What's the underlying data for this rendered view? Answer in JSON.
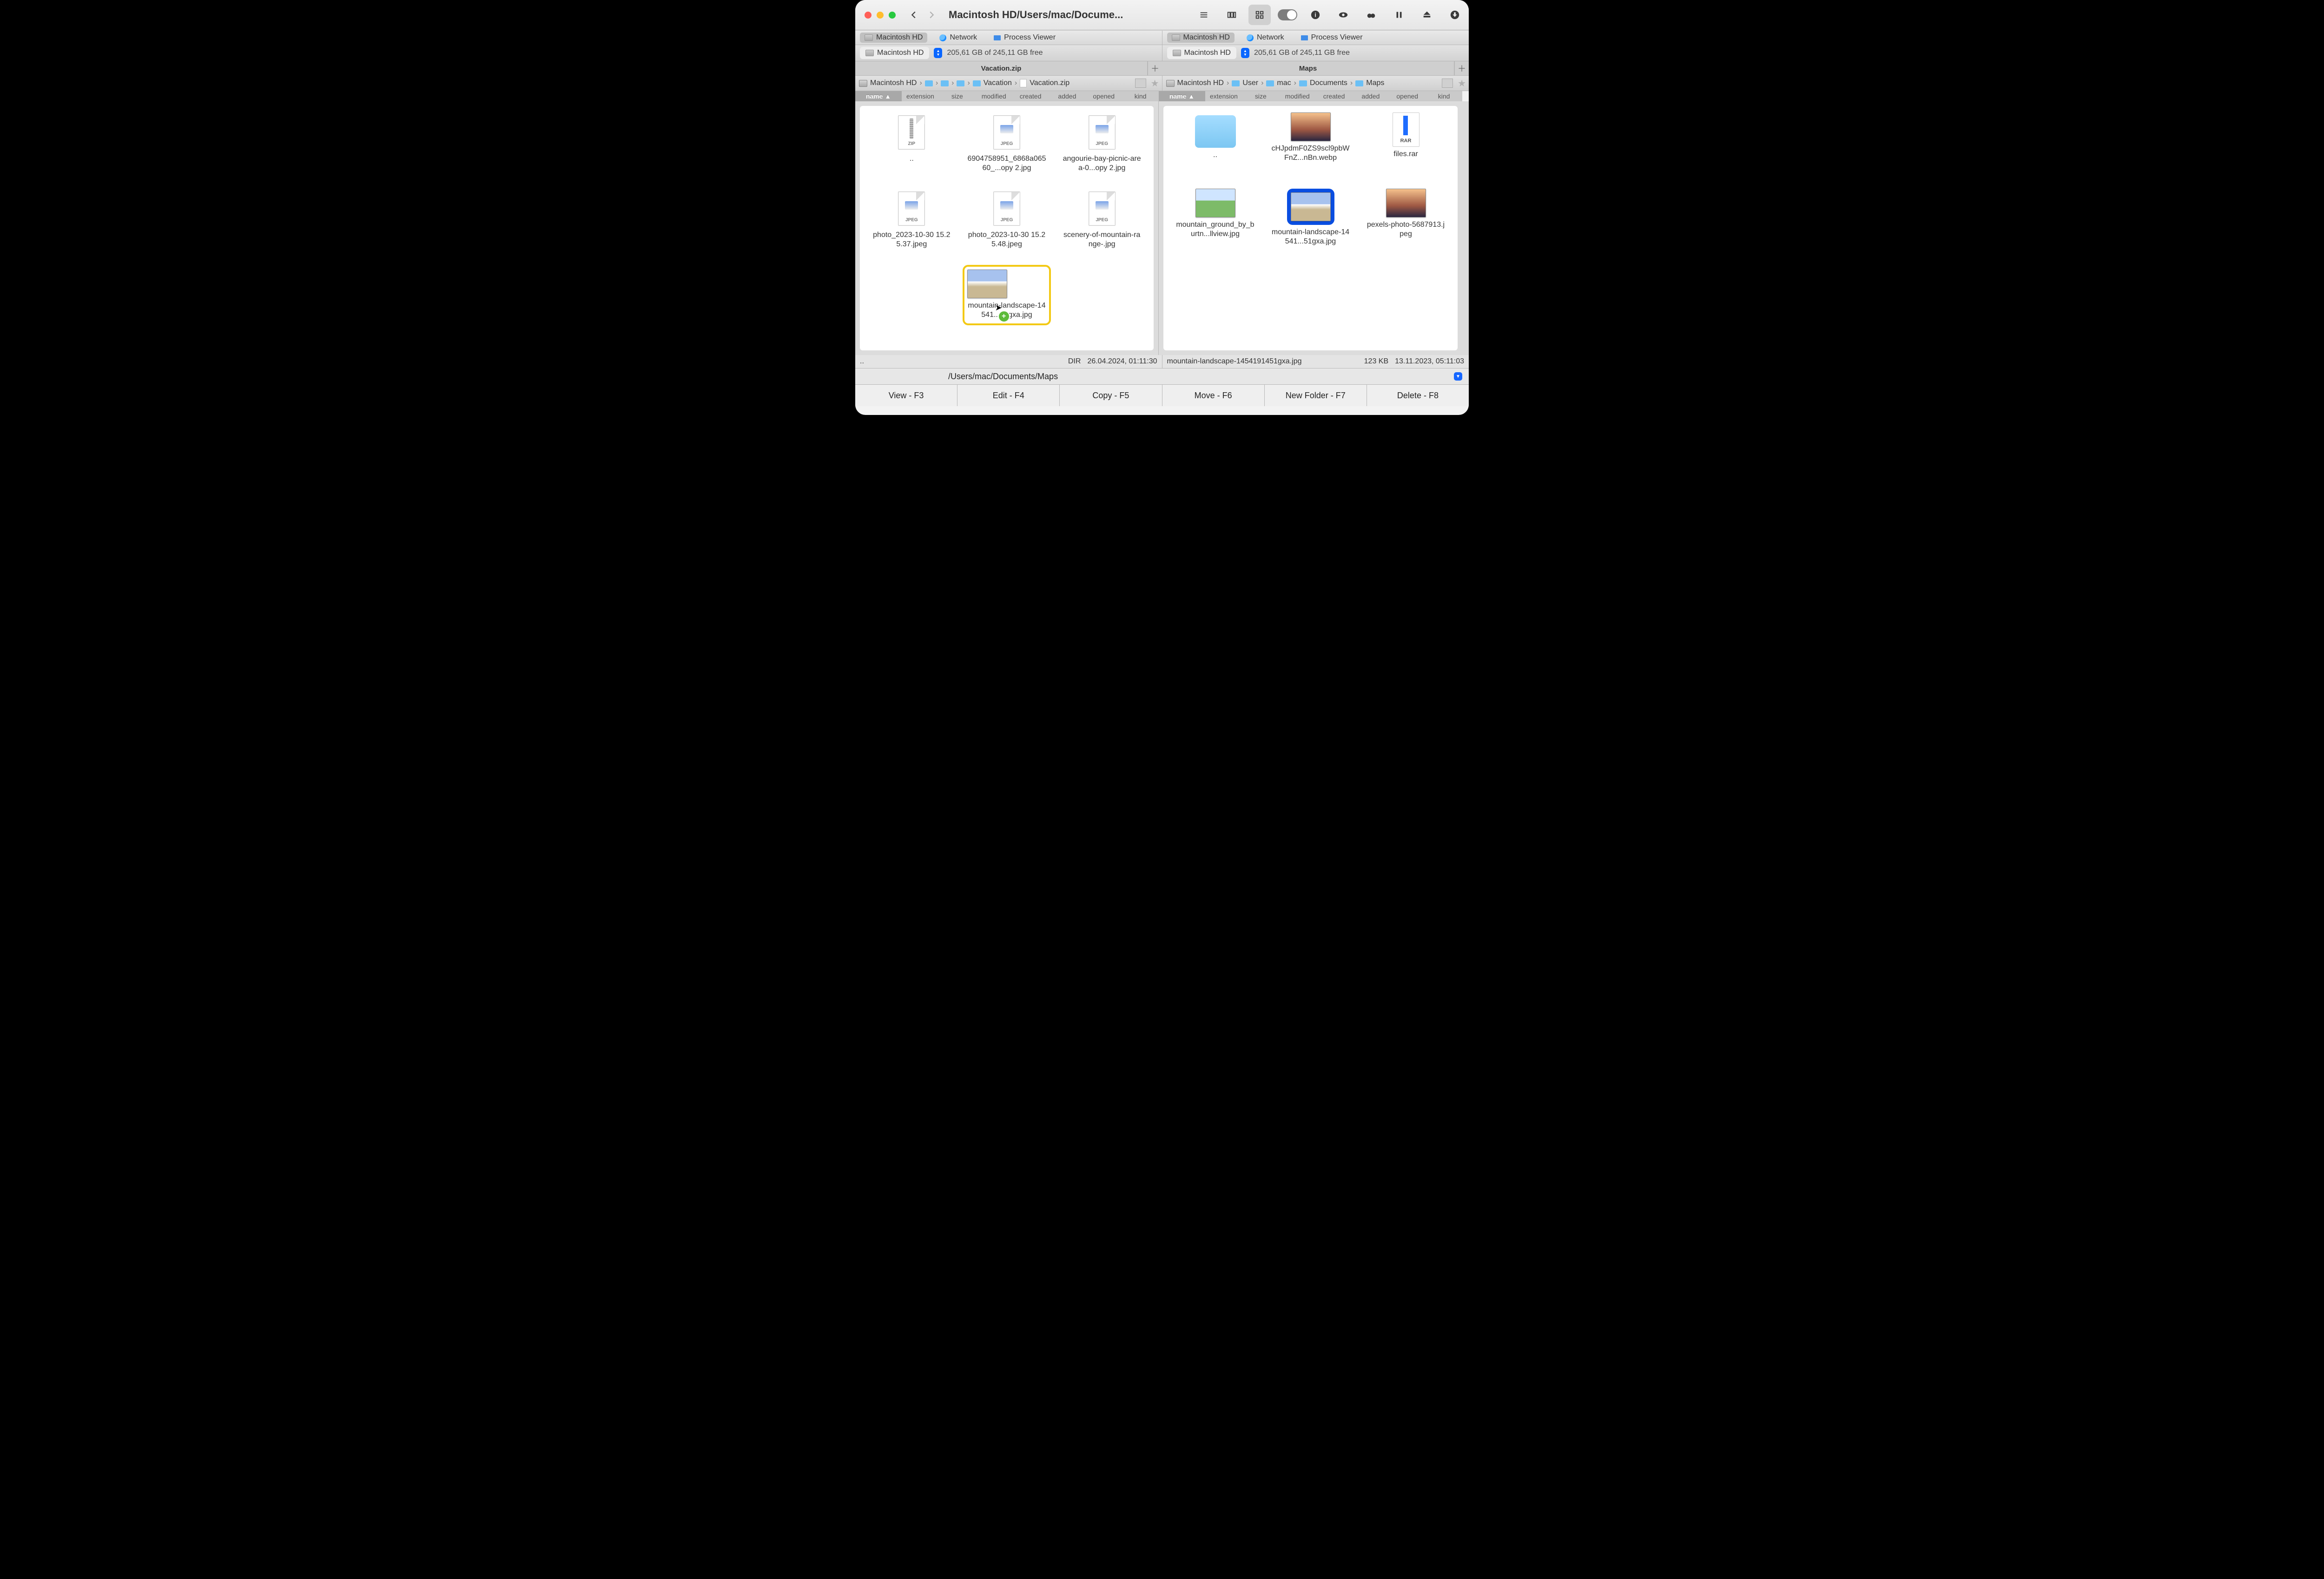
{
  "window": {
    "title": "Macintosh HD/Users/mac/Docume..."
  },
  "loc_tabs": {
    "hd": "Macintosh HD",
    "network": "Network",
    "process": "Process Viewer"
  },
  "disk": {
    "name": "Macintosh HD",
    "free": "205,61 GB of 245,11 GB free"
  },
  "pane_tabs": {
    "left": "Vacation.zip",
    "right": "Maps"
  },
  "crumbs": {
    "left": [
      "Macintosh HD",
      "",
      "",
      "",
      "Vacation",
      "Vacation.zip"
    ],
    "right": [
      "Macintosh HD",
      "User",
      "mac",
      "Documents",
      "Maps"
    ]
  },
  "headers": [
    "name",
    "extension",
    "size",
    "modified",
    "created",
    "added",
    "opened",
    "kind"
  ],
  "left_items": [
    {
      "type": "zip",
      "label": ".."
    },
    {
      "type": "jpeg",
      "label": "6904758951_6868a06560_...opy 2.jpg"
    },
    {
      "type": "jpeg",
      "label": "angourie-bay-picnic-area-0...opy 2.jpg"
    },
    {
      "type": "jpeg",
      "label": "photo_2023-10-30 15.25.37.jpeg"
    },
    {
      "type": "jpeg",
      "label": "photo_2023-10-30 15.25.48.jpeg"
    },
    {
      "type": "jpeg",
      "label": "scenery-of-mountain-range-.jpg"
    }
  ],
  "drag_item": {
    "label": "mountain-landscape-14541...51gxa.jpg"
  },
  "right_items": [
    {
      "type": "folder",
      "label": ".."
    },
    {
      "type": "photo-sunset",
      "label": "cHJpdmF0ZS9scl9pbWFnZ...nBn.webp"
    },
    {
      "type": "rar",
      "label": "files.rar"
    },
    {
      "type": "photo-green",
      "label": "mountain_ground_by_burtn...llview.jpg"
    },
    {
      "type": "photo",
      "label": "mountain-landscape-14541...51gxa.jpg",
      "selected": true
    },
    {
      "type": "photo-sunset",
      "label": "pexels-photo-5687913.jpeg"
    }
  ],
  "status": {
    "left_left": "..",
    "left_right_1": "DIR",
    "left_right_2": "26.04.2024, 01:11:30",
    "right_left": "mountain-landscape-1454191451gxa.jpg",
    "right_right_1": "123 KB",
    "right_right_2": "13.11.2023, 05:11:03"
  },
  "path": "/Users/mac/Documents/Maps",
  "fkeys": [
    "View - F3",
    "Edit - F4",
    "Copy - F5",
    "Move - F6",
    "New Folder - F7",
    "Delete - F8"
  ],
  "tags": {
    "zip": "ZIP",
    "jpeg": "JPEG",
    "rar": "RAR"
  }
}
